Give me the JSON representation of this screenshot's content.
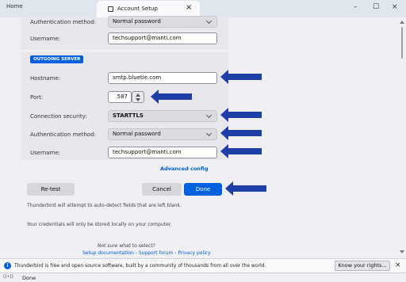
{
  "window": {
    "home_tab": "Home",
    "active_tab": "Account Setup",
    "tab_close": "×",
    "minimize": "–",
    "maximize": "☐",
    "close": "×"
  },
  "incoming": {
    "auth_label": "Authentication method:",
    "auth_value": "Normal password",
    "username_label": "Username:",
    "username_value": "techsupport@manti.com"
  },
  "outgoing": {
    "section_label": "OUTGOING SERVER",
    "hostname_label": "Hostname:",
    "hostname_value": "smtp.bluetie.com",
    "port_label": "Port:",
    "port_value": "587",
    "security_label": "Connection security:",
    "security_value": "STARTTLS",
    "auth_label": "Authentication method:",
    "auth_value": "Normal password",
    "username_label": "Username:",
    "username_value": "techsupport@manti.com"
  },
  "advanced_config": "Advanced config",
  "buttons": {
    "retest": "Re-test",
    "cancel": "Cancel",
    "done": "Done"
  },
  "notes": {
    "auto_detect": "Thunderbird will attempt to auto-detect fields that are left blank.",
    "credentials": "Your credentials will only be stored locally on your computer."
  },
  "help": {
    "question": "Not sure what to select?",
    "setup_docs": "Setup documentation",
    "sep1": " - ",
    "support_forum": "Support forum",
    "sep2": " - ",
    "privacy": "Privacy policy"
  },
  "notification": {
    "message": "Thunderbird is free and open source software, built by a community of thousands from all over the world.",
    "know_rights": "Know your rights...",
    "close": "×",
    "info_glyph": "i"
  },
  "status": {
    "icon": "((•))",
    "text": "Done"
  },
  "colors": {
    "accent": "#0061e0",
    "arrow": "#1f3fa8"
  },
  "icons": {
    "tab": "account-setup-icon",
    "info": "info-icon",
    "status": "activity-icon"
  }
}
